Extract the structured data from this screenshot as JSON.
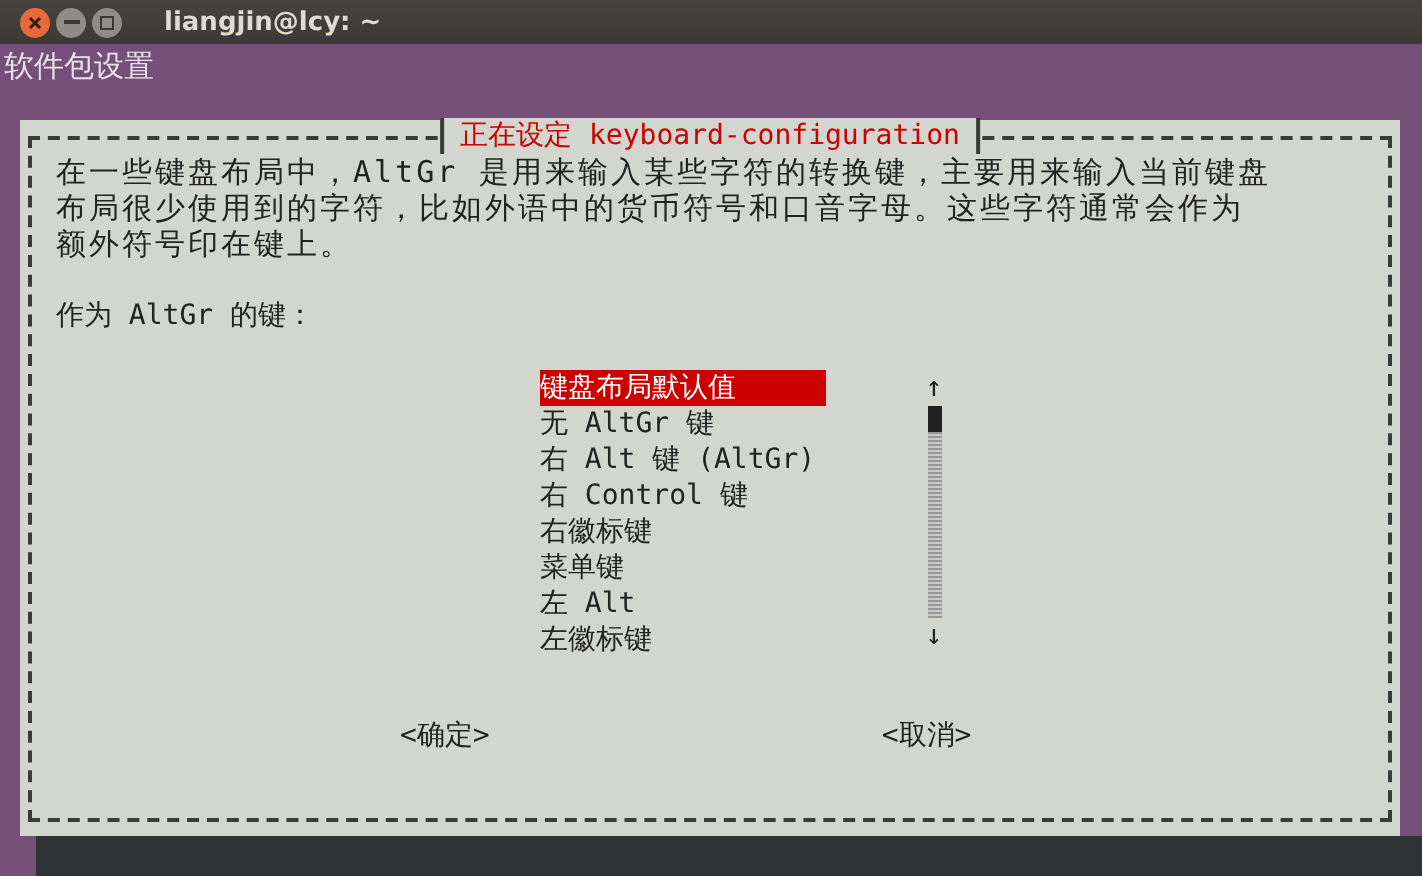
{
  "window": {
    "title": "liangjin@lcy: ~"
  },
  "header": "软件包设置",
  "dialog": {
    "title": "正在设定 keyboard-configuration",
    "description": [
      "在一些键盘布局中，AltGr 是用来输入某些字符的转换键，主要用来输入当前键盘",
      "布局很少使用到的字符，比如外语中的货币符号和口音字母。这些字符通常会作为",
      "额外符号印在键上。"
    ],
    "prompt": "作为 AltGr 的键：",
    "options": [
      {
        "label": "键盘布局默认值",
        "selected": true
      },
      {
        "label": "无 AltGr 键",
        "selected": false
      },
      {
        "label": "右 Alt 键 (AltGr)",
        "selected": false
      },
      {
        "label": "右 Control 键",
        "selected": false
      },
      {
        "label": "右徽标键",
        "selected": false
      },
      {
        "label": "菜单键",
        "selected": false
      },
      {
        "label": "左 Alt",
        "selected": false
      },
      {
        "label": "左徽标键",
        "selected": false
      }
    ],
    "scroll_up": "↑",
    "scroll_down": "↓",
    "buttons": [
      "<确定>",
      "<取消>"
    ]
  }
}
